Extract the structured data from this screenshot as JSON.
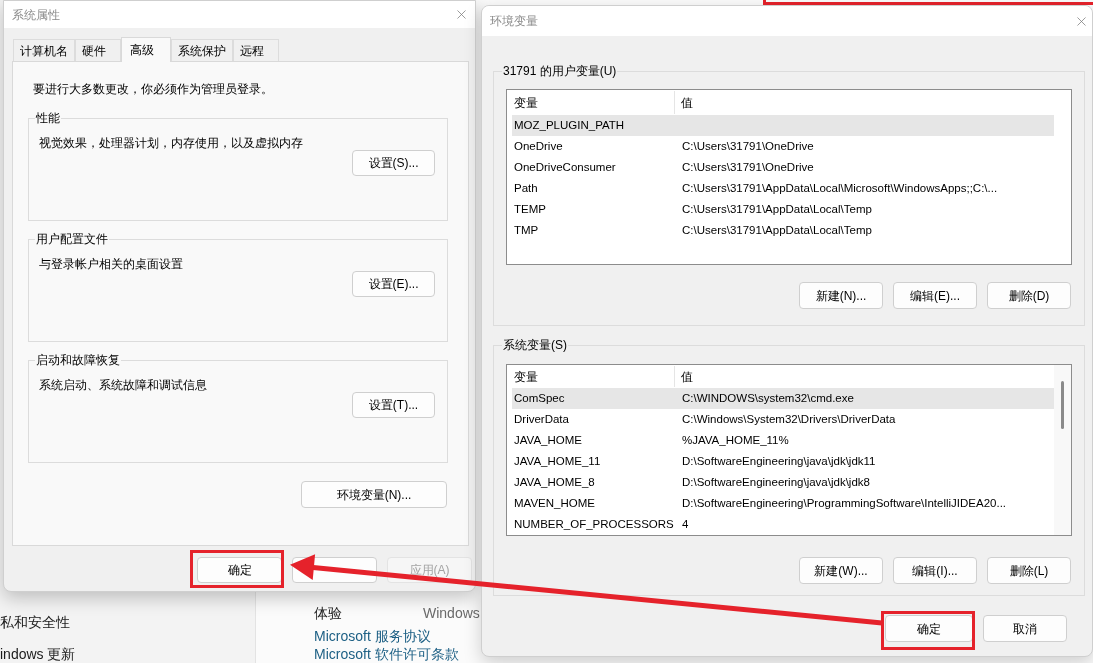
{
  "background_app": {
    "sidebar_items": [
      {
        "label": "私和安全性"
      },
      {
        "label": "indows 更新"
      }
    ],
    "info_row": {
      "label": "体验",
      "value": "Windows"
    },
    "links": [
      "Microsoft 服务协议",
      "Microsoft 软件许可条款"
    ]
  },
  "system_properties": {
    "title": "系统属性",
    "tabs": [
      {
        "label": "计算机名",
        "selected": false
      },
      {
        "label": "硬件",
        "selected": false
      },
      {
        "label": "高级",
        "selected": true
      },
      {
        "label": "系统保护",
        "selected": false
      },
      {
        "label": "远程",
        "selected": false
      }
    ],
    "notice": "要进行大多数更改，你必须作为管理员登录。",
    "groups": [
      {
        "title": "性能",
        "description": "视觉效果，处理器计划，内存使用，以及虚拟内存",
        "button": "设置(S)..."
      },
      {
        "title": "用户配置文件",
        "description": "与登录帐户相关的桌面设置",
        "button": "设置(E)..."
      },
      {
        "title": "启动和故障恢复",
        "description": "系统启动、系统故障和调试信息",
        "button": "设置(T)..."
      }
    ],
    "env_button": "环境变量(N)...",
    "buttons": [
      {
        "label": "确定",
        "disabled": false,
        "highlighted": true
      },
      {
        "disabled": false,
        "highlighted": false
      },
      {
        "label": "应用(A)",
        "disabled": true,
        "highlighted": false
      }
    ]
  },
  "environment_variables": {
    "title": "环境变量",
    "sections": [
      {
        "title": "31791 的用户变量(U)",
        "columns": [
          "变量",
          "值"
        ],
        "rows": [
          {
            "name": "MOZ_PLUGIN_PATH",
            "selected": true
          },
          {
            "name": "OneDrive",
            "value": "C:\\Users\\31791\\OneDrive",
            "selected": false
          },
          {
            "name": "OneDriveConsumer",
            "value": "C:\\Users\\31791\\OneDrive",
            "selected": false
          },
          {
            "name": "Path",
            "value": "C:\\Users\\31791\\AppData\\Local\\Microsoft\\WindowsApps;;C:\\...",
            "selected": false
          },
          {
            "name": "TEMP",
            "value": "C:\\Users\\31791\\AppData\\Local\\Temp",
            "selected": false
          },
          {
            "name": "TMP",
            "value": "C:\\Users\\31791\\AppData\\Local\\Temp",
            "selected": false
          }
        ],
        "buttons": [
          "新建(N)...",
          "编辑(E)...",
          "删除(D)"
        ]
      },
      {
        "title": "系统变量(S)",
        "columns": [
          "变量",
          "值"
        ],
        "rows": [
          {
            "name": "ComSpec",
            "value": "C:\\WINDOWS\\system32\\cmd.exe",
            "selected": true
          },
          {
            "name": "DriverData",
            "value": "C:\\Windows\\System32\\Drivers\\DriverData",
            "selected": false
          },
          {
            "name": "JAVA_HOME",
            "value": "%JAVA_HOME_11%",
            "selected": false
          },
          {
            "name": "JAVA_HOME_11",
            "value": "D:\\SoftwareEngineering\\java\\jdk\\jdk11",
            "selected": false
          },
          {
            "name": "JAVA_HOME_8",
            "value": "D:\\SoftwareEngineering\\java\\jdk\\jdk8",
            "selected": false
          },
          {
            "name": "MAVEN_HOME",
            "value": "D:\\SoftwareEngineering\\ProgrammingSoftware\\IntelliJIDEA20...",
            "selected": false
          },
          {
            "name": "NUMBER_OF_PROCESSORS",
            "value": "4",
            "selected": false
          }
        ],
        "buttons": [
          "新建(W)...",
          "编辑(I)...",
          "删除(L)"
        ]
      }
    ],
    "buttons": [
      {
        "label": "确定",
        "highlighted": true
      },
      {
        "label": "取消",
        "highlighted": false
      }
    ]
  }
}
